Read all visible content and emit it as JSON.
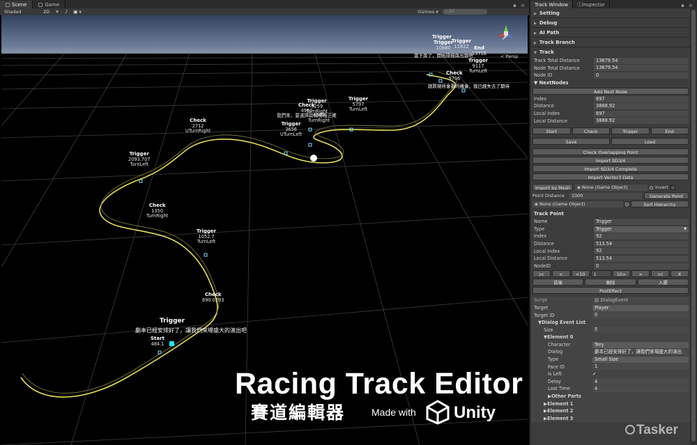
{
  "scene_tab": "Scene",
  "game_tab": "Game",
  "toolbar": {
    "shading": "Shaded",
    "mode2d": "2D",
    "gizmos": "Gizmos",
    "search": "All"
  },
  "persp": "Persp",
  "labels": [
    {
      "title": "Start",
      "value": "484.1"
    },
    {
      "title": "Check",
      "value": "690.0293"
    },
    {
      "title": "Trigger",
      "value": "1052.7",
      "sub": "TurnLeft"
    },
    {
      "title": "Check",
      "value": "1350",
      "sub": "TurnRight"
    },
    {
      "title": "Trigger",
      "value": "2093.707",
      "sub": "TurnLeft"
    },
    {
      "title": "Check",
      "value": "2712",
      "sub": "UTurnRight"
    },
    {
      "title": "Trigger",
      "value": "3656",
      "sub": "UTurnLeft"
    },
    {
      "title": "Check",
      "value": "4960",
      "sub": "我們來，要選擇路線哪種正確"
    },
    {
      "title": "Trigger",
      "value": "5259",
      "sub": "TurnRight"
    },
    {
      "title": "",
      "value": "4560",
      "sub": "TurnRight"
    },
    {
      "title": "Trigger",
      "value": "5797",
      "sub": "TurnLeft"
    },
    {
      "title": "Trigger",
      "value": "9117",
      "sub": "TurnLeft"
    },
    {
      "title": "Check",
      "value": "9706"
    },
    {
      "title": "End",
      "value": "13718"
    },
    {
      "title": "Trigger",
      "value": "11822"
    },
    {
      "title": "Trigger",
      "value": "10880"
    },
    {
      "title": "Trigger",
      "value": ""
    }
  ],
  "dialog_texts": {
    "start": "劇本已經安排好了，讓我們來場盛大的演出吧",
    "start_trigger": "Trigger",
    "end_a": "當下奔了，開始掃描與出發吧",
    "end_b": "跟跌現所會看的機會，我已經失去了期待"
  },
  "brand": {
    "title": "Racing Track Editor",
    "subtitle": "賽道編輯器",
    "made_with": "Made with",
    "unity": "Unity"
  },
  "watermark": "Tasker",
  "right_tabs": [
    "Track Window",
    "Inspector"
  ],
  "folds": [
    "Setting",
    "Debug",
    "AI Path",
    "Track Branch",
    "Track"
  ],
  "track_fields": [
    {
      "k": "Track Total Distance",
      "v": "13679.54"
    },
    {
      "k": "Node Total Distance",
      "v": "13679.54"
    },
    {
      "k": "Node ID",
      "v": "0"
    }
  ],
  "next_nodes": {
    "header": "NextNodes",
    "add_button": "Add Next Node",
    "fields": [
      {
        "k": "Index",
        "v": "697"
      },
      {
        "k": "Distance",
        "v": "3888.92"
      },
      {
        "k": "Local Index",
        "v": "697"
      },
      {
        "k": "Local Distance",
        "v": "3888.92"
      }
    ]
  },
  "type_buttons": [
    "Start",
    "Check",
    "Trigger",
    "End"
  ],
  "save": "Save",
  "load": "Load",
  "wide_buttons": [
    "Check Overlapping Point",
    "Import SD3/4",
    "Import SD3/4 Complete",
    "Import Vector3 Data"
  ],
  "import_mesh": "Import by Mesh",
  "none_go": "None (Game Object)",
  "invert": "Invert",
  "point_distance": {
    "k": "Point Distance",
    "v": "1000",
    "button": "Generate Point"
  },
  "sort_hierarchy": "Sort Hierarchy",
  "track_point": {
    "header": "Track Point",
    "fields": [
      {
        "k": "Name",
        "v": "Trigger"
      },
      {
        "k": "Type",
        "v": "Trigger"
      },
      {
        "k": "Index",
        "v": "92"
      },
      {
        "k": "Distance",
        "v": "513.54"
      },
      {
        "k": "Local Index",
        "v": "92"
      },
      {
        "k": "Local Distance",
        "v": "513.54"
      },
      {
        "k": "NodeID",
        "v": "0"
      }
    ]
  },
  "nav_buttons": [
    "|<",
    "<",
    "<10",
    "1",
    "10>",
    ">",
    ">|",
    "X"
  ],
  "action_buttons": [
    "前後",
    "刪除",
    "入選"
  ],
  "post_effect": "PostEffect",
  "inspector": {
    "script": {
      "k": "Script",
      "v": "DialogEvent"
    },
    "target": {
      "k": "Target",
      "v": "Player"
    },
    "target_id": {
      "k": "Target ID",
      "v": "0"
    },
    "list_header": "Dialog Event List",
    "size": {
      "k": "Size",
      "v": "5"
    },
    "element0": "Element 0",
    "fields": [
      {
        "k": "Character",
        "v": "Tery"
      },
      {
        "k": "Dialog",
        "v": "劇本已經安排好了，讓我們來場盛大的演出"
      },
      {
        "k": "Type",
        "v": "Small Size"
      },
      {
        "k": "Face ID",
        "v": "1"
      },
      {
        "k": "Is Left",
        "v": "✓"
      },
      {
        "k": "Delay",
        "v": "4"
      },
      {
        "k": "Last Time",
        "v": "4"
      }
    ],
    "other_parts": "Other Parts",
    "elements": [
      "Element 1",
      "Element 2",
      "Element 3"
    ]
  },
  "colors": {
    "track": "#e8e05a",
    "checkpoint": "#7fe0ff",
    "start": "#19e8f0",
    "panel": "#3c3c3c"
  }
}
